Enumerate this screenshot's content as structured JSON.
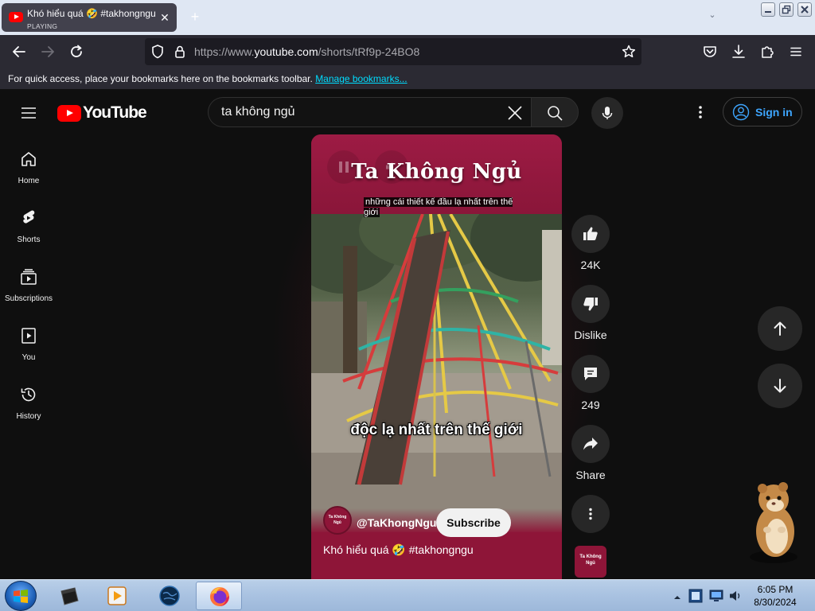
{
  "browser": {
    "tab": {
      "title": "Khó hiểu quá 🤣 #takhongngu",
      "status": "PLAYING"
    },
    "url": {
      "prefix": "https://www.",
      "host": "youtube.com",
      "path": "/shorts/tRf9p-24BO8"
    },
    "bookmarks_bar": {
      "message": "For quick access, place your bookmarks here on the bookmarks toolbar. ",
      "link": "Manage bookmarks..."
    }
  },
  "youtube": {
    "logo_text": "YouTube",
    "search": {
      "value": "ta không ngủ"
    },
    "sign_in": "Sign in",
    "sidebar": [
      {
        "label": "Home",
        "icon": "home-icon"
      },
      {
        "label": "Shorts",
        "icon": "shorts-icon"
      },
      {
        "label": "Subscriptions",
        "icon": "subscriptions-icon"
      },
      {
        "label": "You",
        "icon": "you-icon"
      },
      {
        "label": "History",
        "icon": "history-icon"
      }
    ],
    "short": {
      "overlay_title": "Ta Không Ngủ",
      "overlay_caption": "những cái thiết kế đầu lạ nhất trên thế giới",
      "subtitle": "độc lạ nhất trên thế giới",
      "channel_handle": "@TaKhongNgu",
      "channel_avatar_text": "Ta Không Ngủ",
      "subscribe_label": "Subscribe",
      "description": "Khó hiểu quá 🤣 #takhongngu"
    },
    "actions": {
      "likes": "24K",
      "dislike": "Dislike",
      "comments": "249",
      "share": "Share"
    },
    "accent_colors": {
      "red": "#ff0000",
      "link_blue": "#3ea6ff",
      "player_maroon": "#8e1538"
    }
  },
  "taskbar": {
    "time": "6:05 PM",
    "date": "8/30/2024"
  }
}
